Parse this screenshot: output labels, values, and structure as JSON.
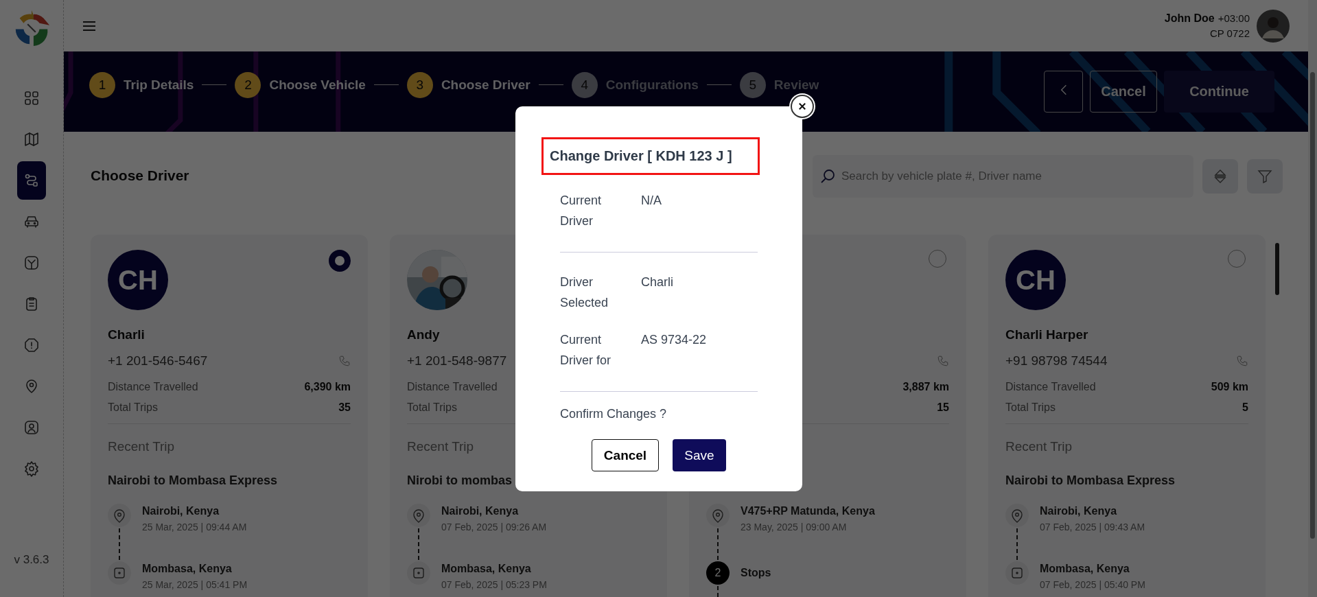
{
  "sidebar": {
    "items": [
      {
        "selected": false
      },
      {
        "selected": false
      },
      {
        "selected": true
      },
      {
        "selected": false
      },
      {
        "selected": false
      },
      {
        "selected": false
      },
      {
        "selected": false
      },
      {
        "selected": false
      },
      {
        "selected": false
      },
      {
        "selected": false
      }
    ],
    "version": "v 3.6.3"
  },
  "user": {
    "name": "John Doe",
    "timezone": "+03:00",
    "code": "CP 0722"
  },
  "stepper": {
    "steps": [
      {
        "number": "1",
        "label": "Trip Details",
        "reached": true
      },
      {
        "number": "2",
        "label": "Choose Vehicle",
        "reached": true
      },
      {
        "number": "3",
        "label": "Choose Driver",
        "reached": true
      },
      {
        "number": "4",
        "label": "Configurations",
        "reached": false
      },
      {
        "number": "5",
        "label": "Review",
        "reached": false
      }
    ],
    "buttons": {
      "cancel": "Cancel",
      "continue": "Continue"
    }
  },
  "page_title": "Choose Driver",
  "search": {
    "placeholder": "Search by vehicle plate #, Driver name"
  },
  "cards": [
    {
      "avatar": {
        "kind": "initials",
        "text": "CH"
      },
      "selected": true,
      "call_icon": true,
      "name": "Charli",
      "phone": "+1 201-546-5467",
      "stats": [
        {
          "label": "Distance Travelled",
          "value": "6,390 km"
        },
        {
          "label": "Total Trips",
          "value": "35"
        }
      ],
      "recent_label": "Recent Trip",
      "trip": "Nairobi to Mombasa Express",
      "stops": [
        {
          "kind": "start",
          "place": "Nairobi, Kenya",
          "time": "25 Mar, 2025 | 09:44 AM"
        },
        {
          "kind": "end",
          "place": "Mombasa, Kenya",
          "time": "25 Mar, 2025 | 05:41 PM"
        }
      ]
    },
    {
      "name": "Andy",
      "phone": "+1 201-548-9877",
      "stats": [
        {
          "label": "Distance Travelled"
        },
        {
          "label": "Total Trips"
        }
      ],
      "recent_label": "Recent Trip",
      "trip": "Nirobi to mombas",
      "stops": [
        {
          "kind": "start",
          "place": "Nairobi, Kenya",
          "time": "07 Feb, 2025 | 09:26 AM"
        },
        {
          "kind": "end",
          "place": "Mombasa, Kenya",
          "time": "07 Feb, 2025 | 05:23 PM"
        }
      ]
    },
    {
      "selected": false,
      "call_icon": true,
      "stats": [
        {
          "value": "3,887 km"
        },
        {
          "value": "15"
        }
      ],
      "stops": [
        {
          "kind": "start",
          "place": "V475+RP Matunda, Kenya",
          "time": "23 May, 2025 | 09:00 AM"
        },
        {
          "kind": "count",
          "count": "2",
          "place": "Stops"
        }
      ]
    },
    {
      "avatar": {
        "kind": "initials",
        "text": "CH"
      },
      "selected": false,
      "call_icon": true,
      "name": "Charli Harper",
      "phone": "+91 98798 74544",
      "stats": [
        {
          "label": "Distance Travelled",
          "value": "509 km"
        },
        {
          "label": "Total Trips",
          "value": "5"
        }
      ],
      "recent_label": "Recent Trip",
      "trip": "Nairobi to Mombasa Express",
      "stops": [
        {
          "kind": "start",
          "place": "Nairobi, Kenya",
          "time": "07 Feb, 2025 | 09:43 AM"
        },
        {
          "kind": "end",
          "place": "Mombasa, Kenya",
          "time": "07 Feb, 2025 | 05:40 PM"
        }
      ]
    }
  ],
  "dialog": {
    "title": "Change Driver [ KDH 123 J ]",
    "sections": [
      [
        {
          "label": "Current Driver",
          "value": "N/A"
        }
      ],
      [
        {
          "label": "Driver Selected",
          "value": "Charli"
        },
        {
          "label": "Current Driver for",
          "value": "AS 9734-22"
        }
      ]
    ],
    "question": "Confirm Changes ?",
    "cancel": "Cancel",
    "save": "Save"
  }
}
